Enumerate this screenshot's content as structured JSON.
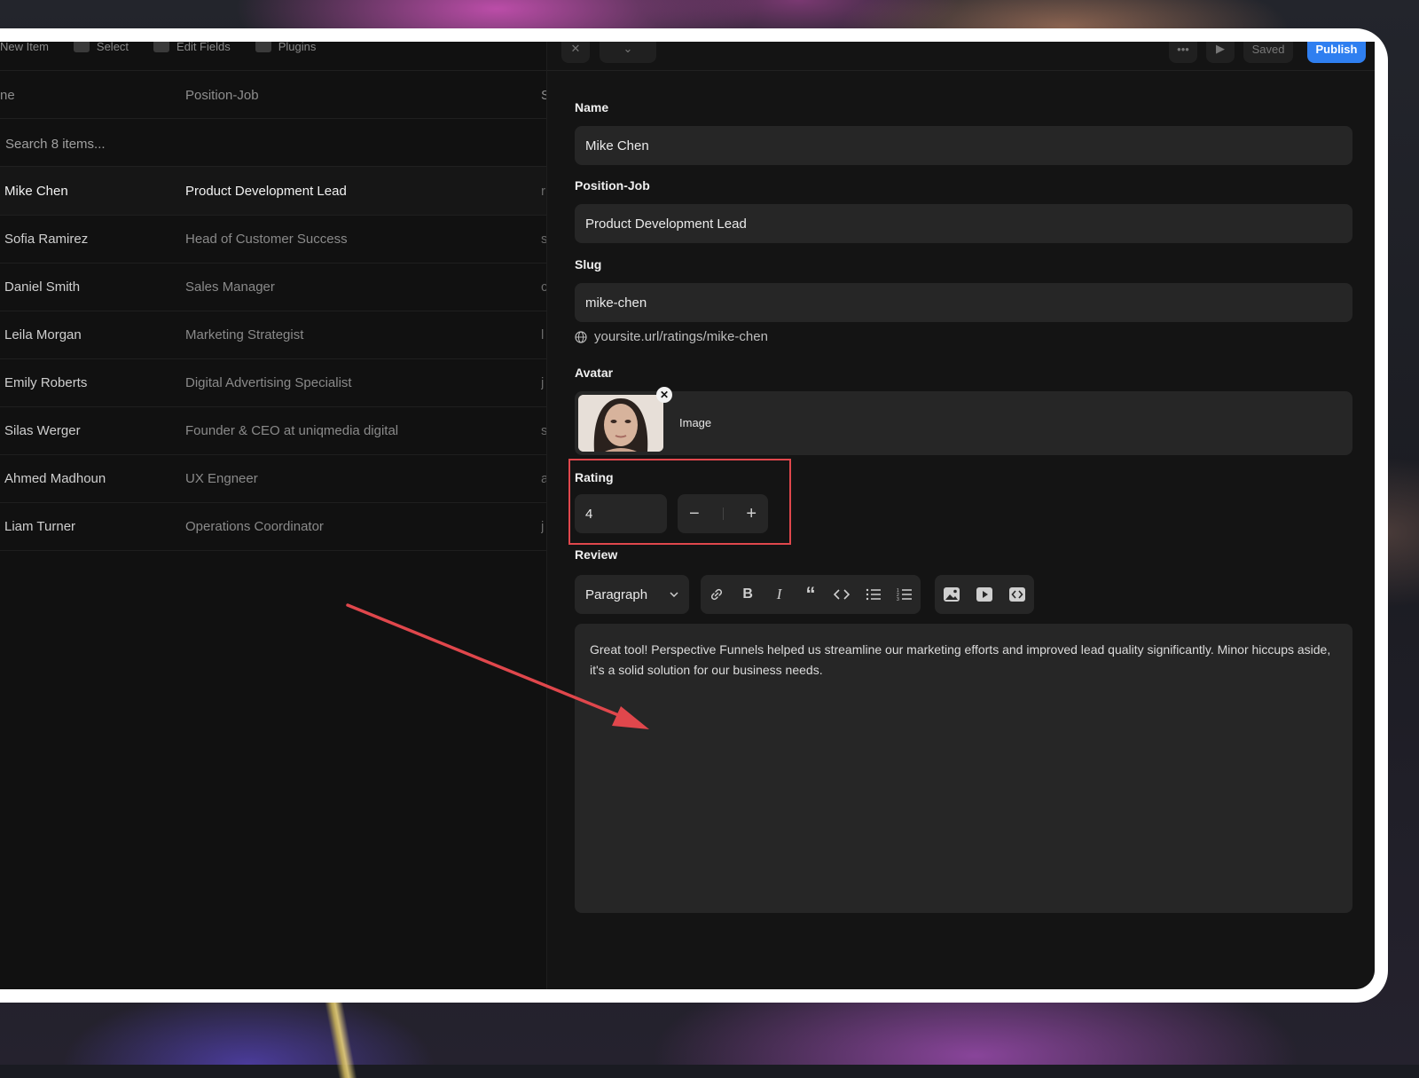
{
  "toolbar": {
    "new_item": "New Item",
    "select": "Select",
    "edit_fields": "Edit Fields",
    "plugins": "Plugins"
  },
  "table": {
    "col_name": "ne",
    "col_position": "Position-Job",
    "col_third": "S",
    "search_placeholder": "Search 8 items...",
    "rows": [
      {
        "name": "Mike Chen",
        "position": "Product Development Lead",
        "slug_initial": "r"
      },
      {
        "name": "Sofia Ramirez",
        "position": "Head of Customer Success",
        "slug_initial": "s"
      },
      {
        "name": "Daniel Smith",
        "position": "Sales Manager",
        "slug_initial": "c"
      },
      {
        "name": "Leila Morgan",
        "position": "Marketing Strategist",
        "slug_initial": "l"
      },
      {
        "name": "Emily Roberts",
        "position": "Digital Advertising Specialist",
        "slug_initial": "j"
      },
      {
        "name": "Silas Werger",
        "position": "Founder & CEO at uniqmedia digital",
        "slug_initial": "s"
      },
      {
        "name": "Ahmed Madhoun",
        "position": "UX Engneer",
        "slug_initial": "a"
      },
      {
        "name": "Liam Turner",
        "position": "Operations Coordinator",
        "slug_initial": "j"
      }
    ]
  },
  "header": {
    "saved_label": "Saved",
    "publish_label": "Publish"
  },
  "form": {
    "name_label": "Name",
    "name_value": "Mike Chen",
    "position_label": "Position-Job",
    "position_value": "Product Development Lead",
    "slug_label": "Slug",
    "slug_value": "mike-chen",
    "url_preview": "yoursite.url/ratings/mike-chen",
    "avatar_label": "Avatar",
    "avatar_type": "Image",
    "rating_label": "Rating",
    "rating_value": "4",
    "review_label": "Review",
    "paragraph_select": "Paragraph",
    "review_text": "Great tool! Perspective Funnels helped us streamline our marketing efforts and improved lead quality significantly. Minor hiccups aside, it's a solid solution for our business needs."
  },
  "icons": [
    "link-icon",
    "bold-icon",
    "italic-icon",
    "quote-icon",
    "code-icon",
    "bullet-list-icon",
    "numbered-list-icon",
    "image-icon",
    "video-icon",
    "embed-icon",
    "globe-icon",
    "close-icon",
    "chevron-down-icon"
  ],
  "colors": {
    "accent": "#2f7ff0",
    "highlight": "#e0474c",
    "arrow": "#e0474c"
  }
}
